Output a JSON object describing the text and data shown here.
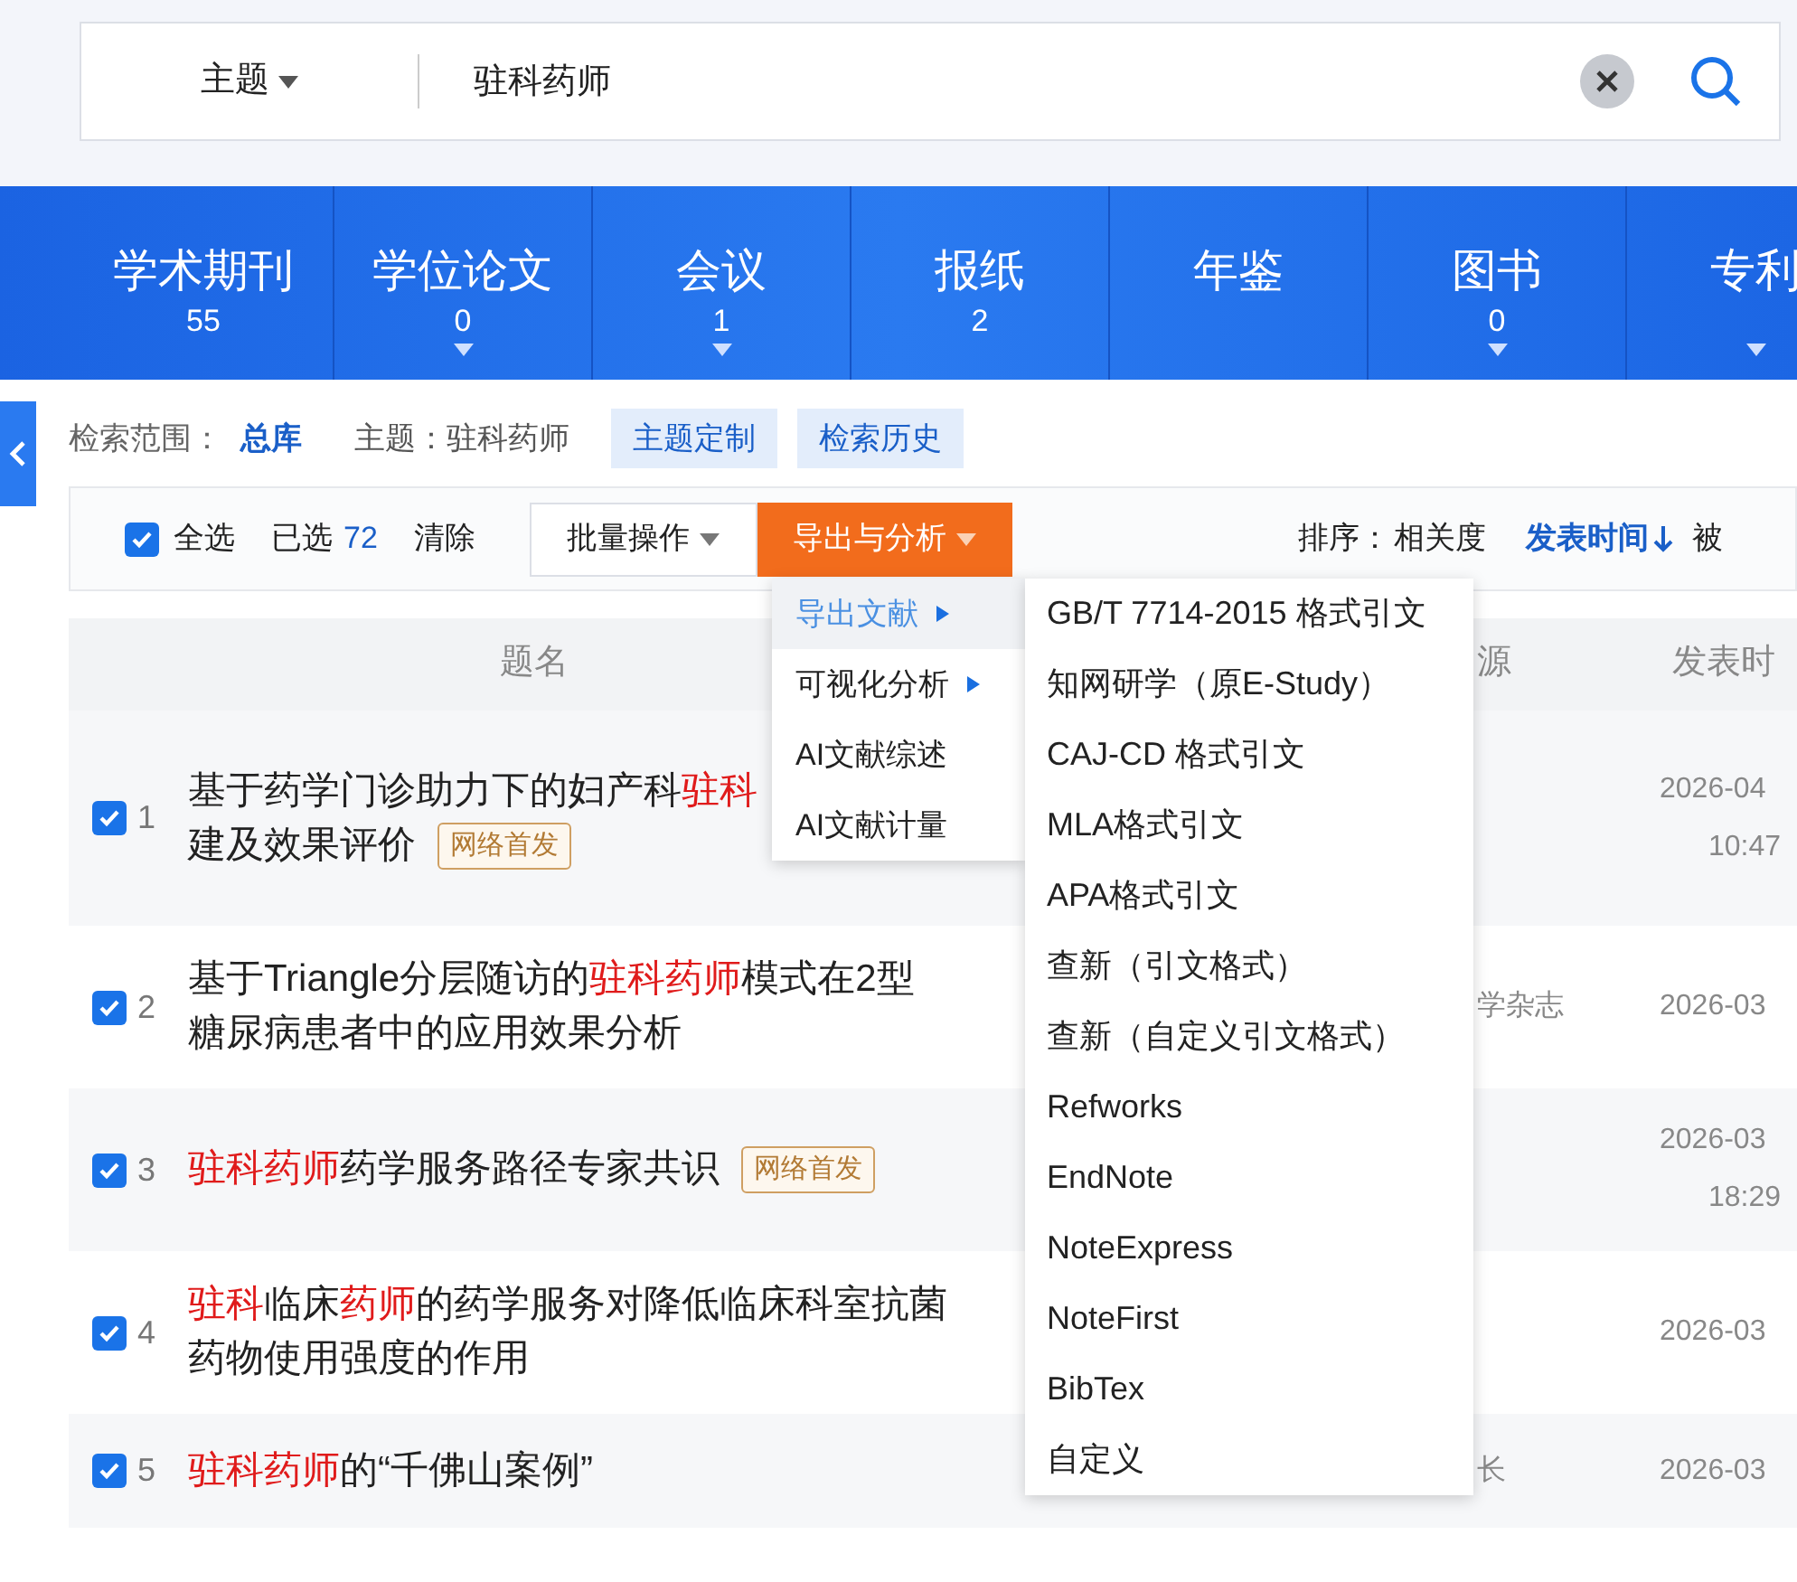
{
  "search": {
    "field": "主题",
    "query": "驻科药师"
  },
  "databases": [
    {
      "label": "学术期刊",
      "count": "55",
      "expandable": false
    },
    {
      "label": "学位论文",
      "count": "0",
      "expandable": true
    },
    {
      "label": "会议",
      "count": "1",
      "expandable": true
    },
    {
      "label": "报纸",
      "count": "2",
      "expandable": false
    },
    {
      "label": "年鉴",
      "expandable": false
    },
    {
      "label": "图书",
      "count": "0",
      "expandable": true
    },
    {
      "label": "专利",
      "expandable": true
    }
  ],
  "scope": {
    "label": "检索范围：",
    "value": "总库",
    "topic": "主题：驻科药师",
    "buttons": [
      "主题定制",
      "检索历史"
    ]
  },
  "toolbar": {
    "select_all": {
      "label": "全选",
      "checked": true
    },
    "selected_label": "已选",
    "selected_count": "72",
    "clear": "清除",
    "batch": "批量操作",
    "export": "导出与分析",
    "sort_label": "排序：",
    "sort_options": [
      {
        "label": "相关度",
        "selected": false,
        "arrow": false
      },
      {
        "label": "发表时间",
        "selected": true,
        "arrow": true
      },
      {
        "label": "被",
        "selected": false,
        "arrow": false
      }
    ]
  },
  "export_menu": {
    "items": [
      {
        "label": "导出文献",
        "submenu": true,
        "highlighted": true
      },
      {
        "label": "可视化分析",
        "submenu": true,
        "highlighted": false
      },
      {
        "label": "AI文献综述",
        "submenu": false,
        "highlighted": false
      },
      {
        "label": "AI文献计量",
        "submenu": false,
        "highlighted": false
      }
    ],
    "submenu": [
      "GB/T 7714-2015 格式引文",
      "知网研学（原E-Study）",
      "CAJ-CD 格式引文",
      "MLA格式引文",
      "APA格式引文",
      "查新（引文格式）",
      "查新（自定义引文格式）",
      "Refworks",
      "EndNote",
      "NoteExpress",
      "NoteFirst",
      "BibTex",
      "自定义"
    ]
  },
  "table": {
    "columns": {
      "title": "题名",
      "column_4": "源",
      "date": "发表时"
    },
    "rows": [
      {
        "number": "1",
        "checked": true,
        "title": [
          [
            {
              "text": "基于药学门诊助力下的妇产科",
              "hit": false
            },
            {
              "text": "驻科",
              "hit": true
            }
          ],
          [
            {
              "text": "建及效果评价",
              "hit": false
            }
          ]
        ],
        "badge": "网络首发",
        "source": "",
        "date": "2026-04",
        "time": "10:47"
      },
      {
        "number": "2",
        "checked": true,
        "title": [
          [
            {
              "text": "基于Triangle分层随访的",
              "hit": false
            },
            {
              "text": "驻科药师",
              "hit": true
            },
            {
              "text": "模式在2型",
              "hit": false
            }
          ],
          [
            {
              "text": "糖尿病患者中的应用效果分析",
              "hit": false
            }
          ]
        ],
        "source": "学杂志",
        "date": "2026-03"
      },
      {
        "number": "3",
        "checked": true,
        "title": [
          [
            {
              "text": "驻科药师",
              "hit": true
            },
            {
              "text": "药学服务路径专家共识",
              "hit": false
            }
          ]
        ],
        "badge": "网络首发",
        "source": "",
        "date": "2026-03",
        "time": "18:29"
      },
      {
        "number": "4",
        "checked": true,
        "title": [
          [
            {
              "text": "驻科",
              "hit": true
            },
            {
              "text": "临床",
              "hit": false
            },
            {
              "text": "药师",
              "hit": true
            },
            {
              "text": "的药学服务对降低临床科室抗菌",
              "hit": false
            }
          ],
          [
            {
              "text": "药物使用强度的作用",
              "hit": false
            }
          ]
        ],
        "source": "",
        "date": "2026-03"
      },
      {
        "number": "5",
        "checked": true,
        "title": [
          [
            {
              "text": "驻科药师",
              "hit": true
            },
            {
              "text": "的“千佛山案例”",
              "hit": false
            }
          ]
        ],
        "source": "长",
        "date": "2026-03"
      }
    ]
  }
}
